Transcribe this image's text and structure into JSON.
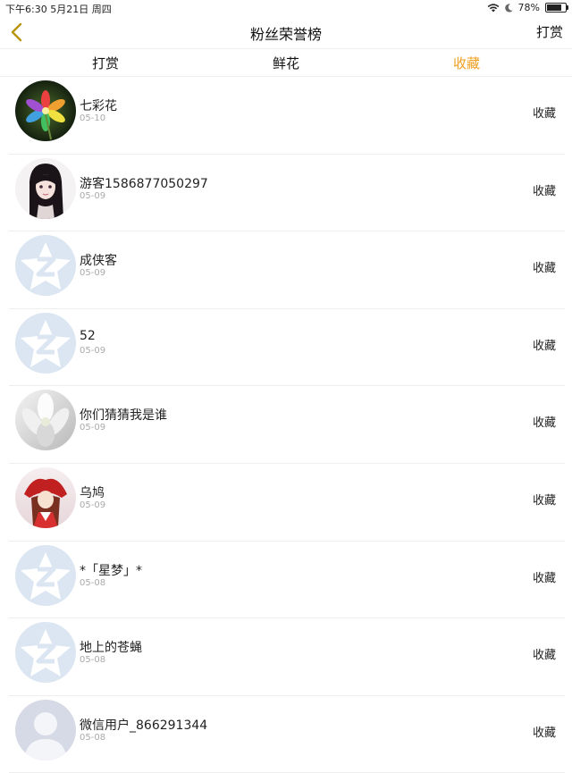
{
  "status_bar": {
    "time_date": "下午6:30   5月21日 周四",
    "battery": "78%",
    "battery_level": 0.78
  },
  "nav": {
    "title": "粉丝荣誉榜",
    "right_action": "打赏"
  },
  "tabs": [
    {
      "label": "打赏",
      "active": false
    },
    {
      "label": "鲜花",
      "active": false
    },
    {
      "label": "收藏",
      "active": true
    }
  ],
  "colors": {
    "accent": "#f0a020",
    "divider": "#eeeeee",
    "secondary_text": "#aaaaaa"
  },
  "rows": [
    {
      "name": "七彩花",
      "date": "05-10",
      "kind": "收藏",
      "avatar": "flower-photo"
    },
    {
      "name": "游客1586877050297",
      "date": "05-09",
      "kind": "收藏",
      "avatar": "anime-girl-photo"
    },
    {
      "name": "成侠客",
      "date": "05-09",
      "kind": "收藏",
      "avatar": "default-qq-avatar"
    },
    {
      "name": "52",
      "date": "05-09",
      "kind": "收藏",
      "avatar": "default-qq-avatar"
    },
    {
      "name": "你们猜猜我是谁",
      "date": "05-09",
      "kind": "收藏",
      "avatar": "white-flower-photo"
    },
    {
      "name": "乌鸠",
      "date": "05-09",
      "kind": "收藏",
      "avatar": "anime-shrine-maiden-photo"
    },
    {
      "name": "*「星梦」*",
      "date": "05-08",
      "kind": "收藏",
      "avatar": "default-qq-avatar"
    },
    {
      "name": "地上的苍蝇",
      "date": "05-08",
      "kind": "收藏",
      "avatar": "default-qq-avatar"
    },
    {
      "name": "微信用户_866291344",
      "date": "05-08",
      "kind": "收藏",
      "avatar": "default-person-avatar"
    }
  ]
}
